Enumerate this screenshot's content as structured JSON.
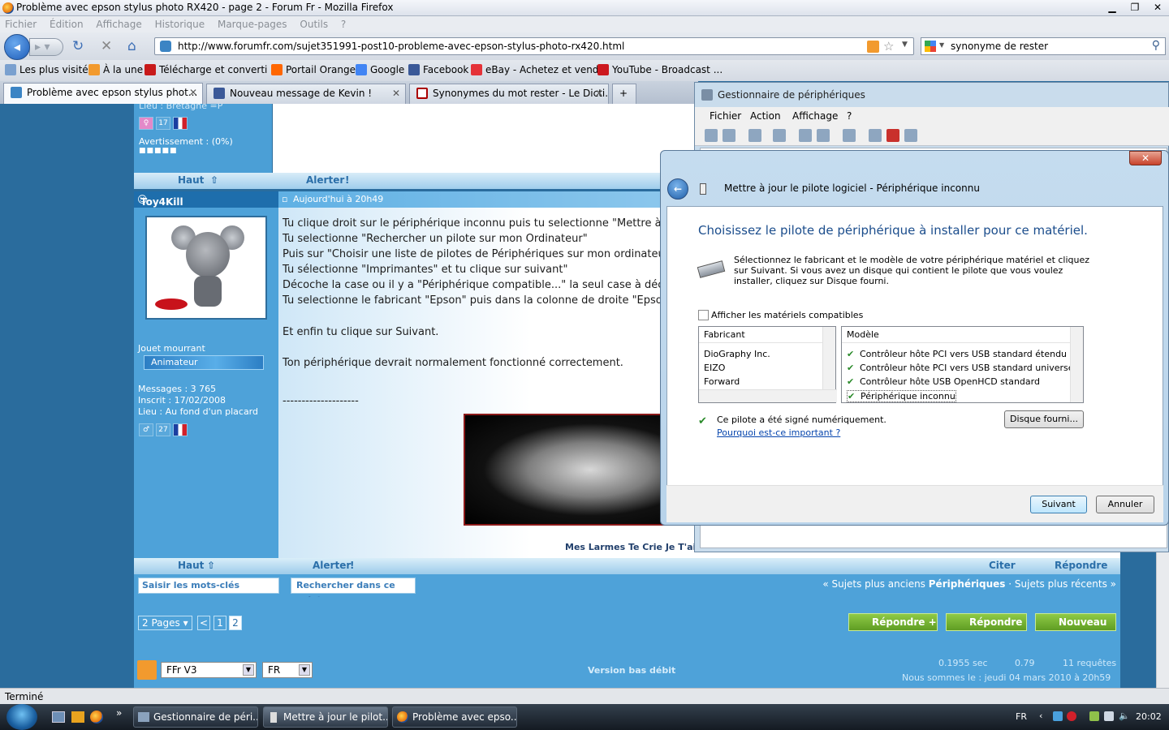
{
  "window": {
    "title": "Problème avec epson stylus photo RX420 - page 2 - Forum Fr - Mozilla Firefox"
  },
  "menu": [
    "Fichier",
    "Édition",
    "Affichage",
    "Historique",
    "Marque-pages",
    "Outils",
    "?"
  ],
  "nav": {
    "url": "http://www.forumfr.com/sujet351991-post10-probleme-avec-epson-stylus-photo-rx420.html",
    "search": "synonyme de rester"
  },
  "bookmarks": [
    "Les plus visités",
    "À la une",
    "Télécharge et converti ...",
    "Portail Orange",
    "Google",
    "Facebook",
    "eBay - Achetez et vend...",
    "YouTube - Broadcast ..."
  ],
  "tabs": [
    "Problème avec epson stylus phot...",
    "Nouveau message de Kevin !",
    "Synonymes du mot rester - Le Dicti..."
  ],
  "forum": {
    "prev_lieu": "Lieu : Bretagne =P",
    "prev_badge_num": "17",
    "warning": "Avertissement : (0%)",
    "haut": "Haut",
    "alerter": "Alerter",
    "author": "Toy4Kill",
    "date": "Aujourd'hui à 20h49",
    "rank": "Jouet mourrant",
    "role": "Animateur",
    "messages": "Messages : 3 765",
    "inscrit": "Inscrit : 17/02/2008",
    "lieu": "Lieu : Au fond d'un placard",
    "badge_num": "27",
    "post_lines": [
      "Tu clique droit sur le périphérique inconnu puis tu selectionne \"Mettre à jo",
      "Tu selectionne \"Rechercher un pilote sur mon Ordinateur\"",
      "Puis sur \"Choisir une liste de pilotes de Périphériques sur mon ordinateur",
      "Tu sélectionne \"Imprimantes\" et tu clique sur suivant\"",
      "Décoche la case ou il y a \"Périphérique compatible...\" la seul case à décoc",
      "Tu selectionne le fabricant \"Epson\" puis dans la colonne de droite \"Epson",
      "Et enfin tu clique sur Suivant.",
      "Ton périphérique devrait normalement fonctionné correctement.",
      "--------------------"
    ],
    "signature": "Mes Larmes Te Crie Je T'aim",
    "citer": "Citer",
    "repondre": "Répondre",
    "kw_placeholder": "Saisir les mots-clés",
    "search_thread": "Rechercher dans ce sujet",
    "older": "« Sujets plus anciens",
    "category": "Périphériques",
    "newer": "Sujets plus récents »",
    "pages": "2 Pages",
    "page_prev": "<",
    "page1": "1",
    "page2": "2",
    "btn_repondre_plus": "Répondre +",
    "btn_repondre": "Répondre",
    "btn_nouveau": "Nouveau",
    "theme": "FFr V3",
    "lang": "FR",
    "low_bandwidth": "Version bas débit",
    "stats_time": "0.1955 sec",
    "stats_load": "0.79",
    "stats_req": "11 requêtes",
    "now": "Nous sommes le : jeudi 04 mars 2010 à 20h59"
  },
  "status": "Terminé",
  "device_manager": {
    "title": "Gestionnaire de périphériques",
    "menu": [
      "Fichier",
      "Action",
      "Affichage",
      "?"
    ]
  },
  "dialog": {
    "header": "Mettre à jour le pilote logiciel - Périphérique inconnu",
    "heading": "Choisissez le pilote de périphérique à installer pour ce matériel.",
    "desc": "Sélectionnez le fabricant et le modèle de votre périphérique matériel et cliquez sur Suivant. Si vous avez un disque qui contient le pilote que vous voulez installer, cliquez sur Disque fourni.",
    "compat": "Afficher les matériels compatibles",
    "manufacturer_header": "Fabricant",
    "manufacturers": [
      "DioGraphy Inc.",
      "EIZO",
      "Forward"
    ],
    "model_header": "Modèle",
    "models": [
      "Contrôleur hôte PCI vers USB standard étendu",
      "Contrôleur hôte PCI vers USB standard universel",
      "Contrôleur hôte USB OpenHCD standard",
      "Périphérique inconnu"
    ],
    "signed": "Ce pilote a été signé numériquement.",
    "why": "Pourquoi est-ce important ?",
    "disk": "Disque fourni...",
    "next": "Suivant",
    "cancel": "Annuler"
  },
  "taskbar": {
    "items": [
      "Gestionnaire de péri...",
      "Mettre à jour le pilot...",
      "Problème avec epso..."
    ],
    "lang": "FR",
    "time": "20:02"
  }
}
